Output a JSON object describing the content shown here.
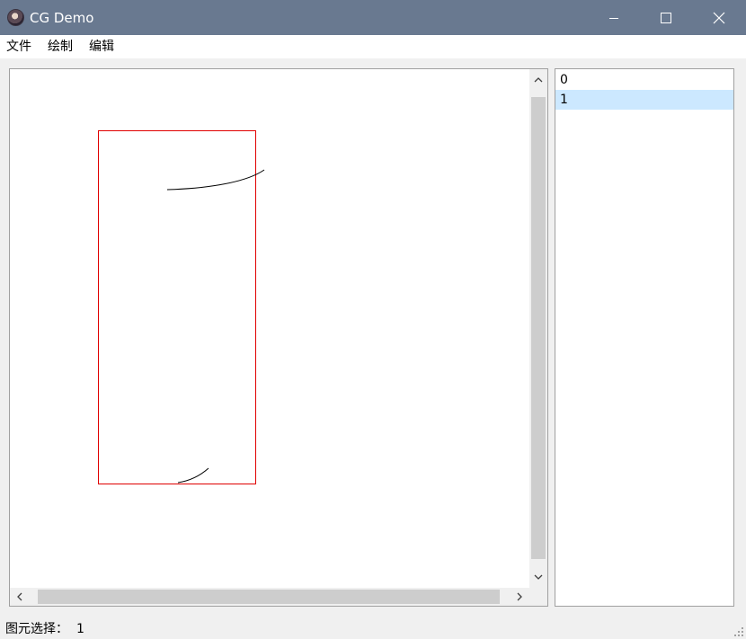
{
  "window": {
    "title": "CG Demo",
    "title_bar_color": "#697990"
  },
  "menu": {
    "file": "文件",
    "draw": "绘制",
    "edit": "编辑"
  },
  "canvas": {
    "background": "#ffffff",
    "selection_box_color": "#e00000",
    "stroke_color": "#000000"
  },
  "list": {
    "items": [
      {
        "label": "0",
        "selected": false
      },
      {
        "label": "1",
        "selected": true
      }
    ],
    "selected_color": "#cce8ff"
  },
  "status": {
    "label": "图元选择：",
    "value": "1"
  },
  "icons": {
    "app": "app-icon",
    "minimize": "minimize-icon",
    "maximize": "maximize-icon",
    "close": "close-icon"
  }
}
